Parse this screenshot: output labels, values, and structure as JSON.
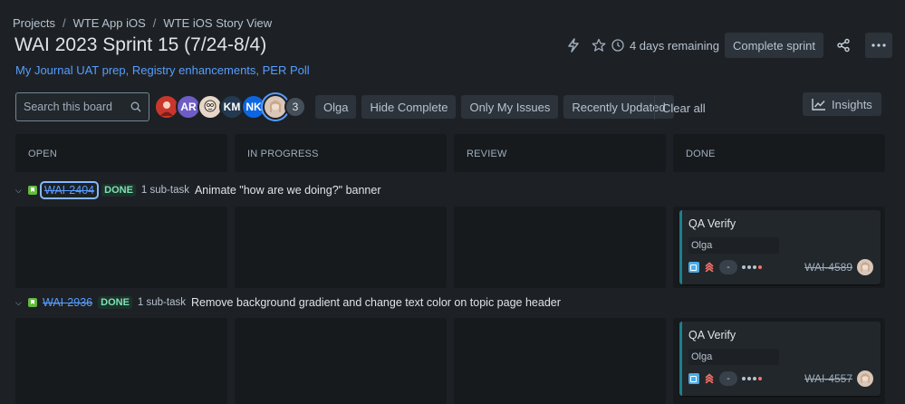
{
  "breadcrumb": [
    "Projects",
    "WTE App iOS",
    "WTE iOS Story View"
  ],
  "page_title": "WAI 2023 Sprint 15 (7/24-8/4)",
  "sprint_goal": "My Journal UAT prep, Registry enhancements, PER Poll",
  "header": {
    "days_remaining": "4 days remaining",
    "complete_sprint": "Complete sprint"
  },
  "toolbar": {
    "search_placeholder": "Search this board",
    "avatars": [
      {
        "initials": "",
        "color": "#c9372c"
      },
      {
        "initials": "AR",
        "color": "#6e5dc6"
      },
      {
        "initials": "",
        "color": "#e8d7c8"
      },
      {
        "initials": "KM",
        "color": "#22394f"
      },
      {
        "initials": "NK",
        "color": "#0c66e4"
      },
      {
        "initials": "",
        "color": "#d9c6b8"
      }
    ],
    "avatar_more": "3",
    "filters": [
      "Olga",
      "Hide Complete",
      "Only My Issues",
      "Recently Updated"
    ],
    "clear_all": "Clear all",
    "insights": "Insights"
  },
  "columns": [
    "OPEN",
    "IN PROGRESS",
    "REVIEW",
    "DONE"
  ],
  "swimlanes": [
    {
      "key": "WAI-2404",
      "status": "DONE",
      "subtasks": "1 sub-task",
      "summary": "Animate \"how are we doing?\" banner",
      "card": {
        "title": "QA Verify",
        "epic": "Olga",
        "estimate": "-",
        "key": "WAI-4589"
      }
    },
    {
      "key": "WAI-2936",
      "status": "DONE",
      "subtasks": "1 sub-task",
      "summary": "Remove background gradient and change text color on topic page header",
      "card": {
        "title": "QA Verify",
        "epic": "Olga",
        "estimate": "-",
        "key": "WAI-4557"
      }
    }
  ]
}
